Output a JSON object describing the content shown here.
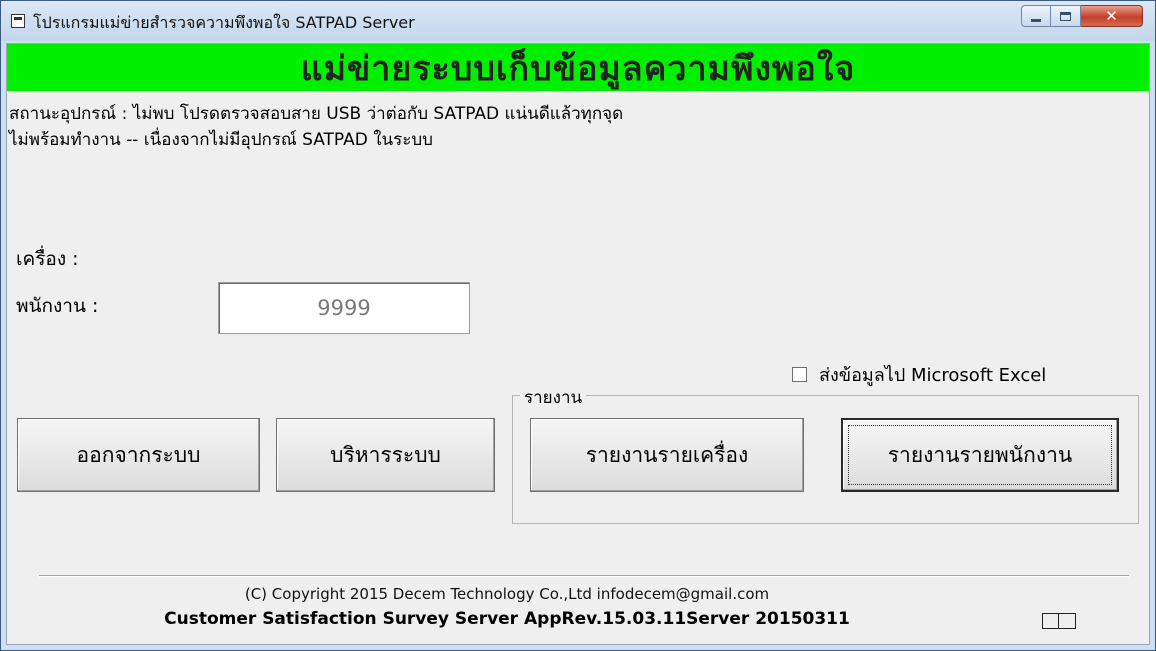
{
  "window": {
    "title": "โปรแกรมแม่ข่ายสำรวจความพึงพอใจ SATPAD Server"
  },
  "banner": {
    "text": "แม่ข่ายระบบเก็บข้อมูลความพึงพอใจ"
  },
  "status": {
    "line1": "สถานะอุปกรณ์ : ไม่พบ  โปรดตรวจสอบสาย USB ว่าต่อกับ SATPAD แน่นดีแล้วทุกจุด",
    "line2": "ไม่พร้อมทำงาน  -- เนื่องจากไม่มีอุปกรณ์ SATPAD ในระบบ"
  },
  "form": {
    "machine_label": "เครื่อง :",
    "employee_label": "พนักงาน :",
    "employee_value": "9999"
  },
  "export": {
    "checkbox_label": "ส่งข้อมูลไป Microsoft Excel",
    "checked": false
  },
  "buttons": {
    "exit": "ออกจากระบบ",
    "admin": "บริหารระบบ"
  },
  "report_group": {
    "title": "รายงาน",
    "by_machine": "รายงานรายเครื่อง",
    "by_employee": "รายงานรายพนักงาน"
  },
  "footer": {
    "copyright": "(C) Copyright 2015 Decem Technology Co.,Ltd  infodecem@gmail.com",
    "version": "Customer Satisfaction Survey Server AppRev.15.03.11Server 20150311"
  },
  "icons": {
    "app": "window-app-icon",
    "minimize": "minimize-icon",
    "maximize": "maximize-icon",
    "close": "close-icon",
    "keyboard": "keyboard-indicator-icon"
  },
  "colors": {
    "banner": "#00f000",
    "close_button": "#c4402a"
  }
}
